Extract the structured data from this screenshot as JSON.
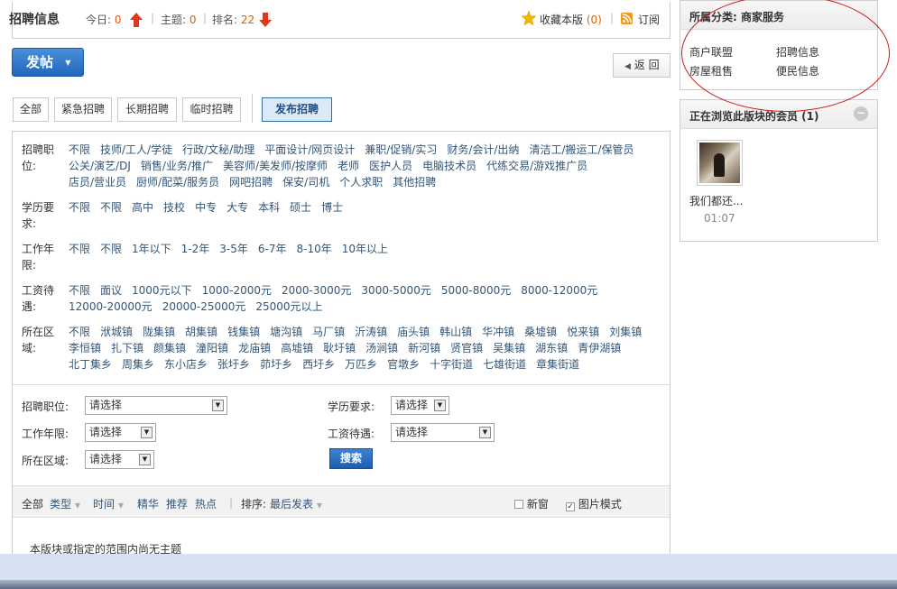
{
  "header": {
    "title": "招聘信息",
    "today_label": "今日:",
    "today_value": "0",
    "topics_label": "主题:",
    "topics_value": "0",
    "rank_label": "排名:",
    "rank_value": "22",
    "favorite_label": "收藏本版",
    "favorite_count": "(0)",
    "subscribe_label": "订阅",
    "separator": "|"
  },
  "actions": {
    "post_label": "发帖",
    "back_label": "返 回"
  },
  "tabs": [
    {
      "label": "全部"
    },
    {
      "label": "紧急招聘"
    },
    {
      "label": "长期招聘"
    },
    {
      "label": "临时招聘"
    }
  ],
  "publish_tab": "发布招聘",
  "filters": [
    {
      "label_line1": "招聘职",
      "label_line2": "位:",
      "options": [
        "不限",
        "技师/工人/学徒",
        "行政/文秘/助理",
        "平面设计/网页设计",
        "兼职/促销/实习",
        "财务/会计/出纳",
        "清洁工/搬运工/保管员",
        "公关/演艺/DJ",
        "销售/业务/推广",
        "美容师/美发师/按摩师",
        "老师",
        "医护人员",
        "电脑技术员",
        "代练交易/游戏推广员",
        "店员/营业员",
        "厨师/配菜/服务员",
        "网吧招聘",
        "保安/司机",
        "个人求职",
        "其他招聘"
      ]
    },
    {
      "label_line1": "学历要",
      "label_line2": "求:",
      "options": [
        "不限",
        "不限",
        "高中",
        "技校",
        "中专",
        "大专",
        "本科",
        "硕士",
        "博士"
      ]
    },
    {
      "label_line1": "工作年",
      "label_line2": "限:",
      "options": [
        "不限",
        "不限",
        "1年以下",
        "1-2年",
        "3-5年",
        "6-7年",
        "8-10年",
        "10年以上"
      ]
    },
    {
      "label_line1": "工资待",
      "label_line2": "遇:",
      "options": [
        "不限",
        "面议",
        "1000元以下",
        "1000-2000元",
        "2000-3000元",
        "3000-5000元",
        "5000-8000元",
        "8000-12000元",
        "12000-20000元",
        "20000-25000元",
        "25000元以上"
      ]
    },
    {
      "label_line1": "所在区",
      "label_line2": "域:",
      "options": [
        "不限",
        "洑城镇",
        "陇集镇",
        "胡集镇",
        "钱集镇",
        "塘沟镇",
        "马厂镇",
        "沂涛镇",
        "庙头镇",
        "韩山镇",
        "华冲镇",
        "桑墟镇",
        "悦来镇",
        "刘集镇",
        "李恒镇",
        "扎下镇",
        "颜集镇",
        "潼阳镇",
        "龙庙镇",
        "高墟镇",
        "耿圩镇",
        "汤涧镇",
        "新河镇",
        "贤官镇",
        "吴集镇",
        "湖东镇",
        "青伊湖镇",
        "北丁集乡",
        "周集乡",
        "东小店乡",
        "张圩乡",
        "茆圩乡",
        "西圩乡",
        "万匹乡",
        "官墩乡",
        "十字街道",
        "七雄街道",
        "章集街道"
      ]
    }
  ],
  "search_form": {
    "job_label": "招聘职位:",
    "edu_label": "学历要求:",
    "years_label": "工作年限:",
    "salary_label": "工资待遇:",
    "area_label": "所在区域:",
    "select_value": "请选择",
    "search_label": "搜索"
  },
  "sortbar": {
    "all": "全部",
    "type": "类型",
    "time": "时间",
    "digest": "精华",
    "recommend": "推荐",
    "hot": "热点",
    "sort_label": "排序:",
    "sort_value": "最后发表",
    "new_window": "新窗",
    "image_mode": "图片模式",
    "new_window_checked": false,
    "image_mode_checked": true
  },
  "empty_message": "本版块或指定的范围内尚无主题",
  "sidebar": {
    "category_title": "所属分类: 商家服务",
    "categories": [
      "商户联盟",
      "招聘信息",
      "房屋租售",
      "便民信息"
    ],
    "members_title": "正在浏览此版块的会员 (1)",
    "member_name": "我们都还...",
    "member_time": "01:07"
  },
  "colors": {
    "accent_red": "#e05d00",
    "link": "#335577",
    "annotation": "#d11818"
  }
}
